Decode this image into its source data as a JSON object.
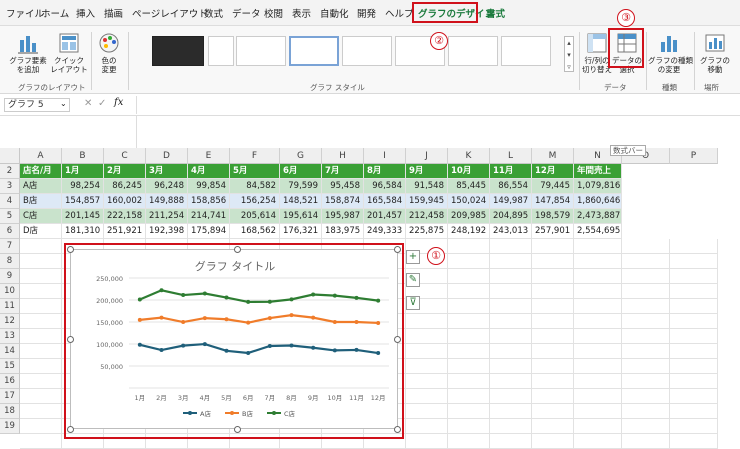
{
  "tabs": [
    "ファイル",
    "ホーム",
    "挿入",
    "描画",
    "ページレイアウト",
    "数式",
    "データ",
    "校閲",
    "表示",
    "自動化",
    "開発",
    "ヘルプ",
    "グラフのデザイン",
    "書式"
  ],
  "callouts": [
    "①",
    "②",
    "③"
  ],
  "ribbon": {
    "add_element": "グラフ要素\nを追加",
    "quick_layout": "クイック\nレイアウト",
    "change_color": "色の\n変更",
    "group_layout": "グラフのレイアウト",
    "group_style": "グラフ スタイル",
    "switch_rowcol": "行/列の\n切り替え",
    "select_data": "データの\n選択",
    "change_type": "グラフの種類\nの変更",
    "move_chart": "グラフの\n移動",
    "group_data": "データ",
    "group_type": "種類",
    "group_location": "場所"
  },
  "formula_bar": {
    "name_box": "グラフ 5",
    "fx": "fx"
  },
  "tooltip": "数式バー",
  "columns": [
    "A",
    "B",
    "C",
    "D",
    "E",
    "F",
    "G",
    "H",
    "I",
    "J",
    "K",
    "L",
    "M",
    "N",
    "O",
    "P"
  ],
  "rows": [
    "2",
    "3",
    "4",
    "5",
    "6",
    "7",
    "8",
    "9",
    "10",
    "11",
    "12",
    "13",
    "14",
    "15",
    "16",
    "17",
    "18",
    "19"
  ],
  "table": {
    "header": [
      "店名/月",
      "1月",
      "2月",
      "3月",
      "4月",
      "5月",
      "6月",
      "7月",
      "8月",
      "9月",
      "10月",
      "11月",
      "12月",
      "年間売上"
    ],
    "data": [
      [
        "A店",
        "98,254",
        "86,245",
        "96,248",
        "99,854",
        "84,582",
        "79,599",
        "95,458",
        "96,584",
        "91,548",
        "85,445",
        "86,554",
        "79,445",
        "1,079,816"
      ],
      [
        "B店",
        "154,857",
        "160,002",
        "149,888",
        "158,856",
        "156,254",
        "148,521",
        "158,874",
        "165,584",
        "159,945",
        "150,024",
        "149,987",
        "147,854",
        "1,860,646"
      ],
      [
        "C店",
        "201,145",
        "222,158",
        "211,254",
        "214,741",
        "205,614",
        "195,614",
        "195,987",
        "201,457",
        "212,458",
        "209,985",
        "204,895",
        "198,579",
        "2,473,887"
      ],
      [
        "D店",
        "181,310",
        "251,921",
        "192,398",
        "175,894",
        "168,562",
        "176,321",
        "183,975",
        "249,333",
        "225,875",
        "248,192",
        "243,013",
        "257,901",
        "2,554,695"
      ]
    ]
  },
  "chart_data": {
    "type": "line",
    "title": "グラフ タイトル",
    "categories": [
      "1月",
      "2月",
      "3月",
      "4月",
      "5月",
      "6月",
      "7月",
      "8月",
      "9月",
      "10月",
      "11月",
      "12月"
    ],
    "series": [
      {
        "name": "A店",
        "color": "#1f5f7a",
        "values": [
          98254,
          86245,
          96248,
          99854,
          84582,
          79599,
          95458,
          96584,
          91548,
          85445,
          86554,
          79445
        ]
      },
      {
        "name": "B店",
        "color": "#f07c2a",
        "values": [
          154857,
          160002,
          149888,
          158856,
          156254,
          148521,
          158874,
          165584,
          159945,
          150024,
          149987,
          147854
        ]
      },
      {
        "name": "C店",
        "color": "#2e7d32",
        "values": [
          201145,
          222158,
          211254,
          214741,
          205614,
          195614,
          195987,
          201457,
          212458,
          209985,
          204895,
          198579
        ]
      }
    ],
    "yticks": [
      "250,000",
      "200,000",
      "150,000",
      "100,000",
      "50,000",
      ""
    ],
    "ylim": [
      0,
      250000
    ],
    "legend": "bottom",
    "grid": true
  },
  "side_buttons": [
    "+",
    "✎",
    "⊽"
  ]
}
